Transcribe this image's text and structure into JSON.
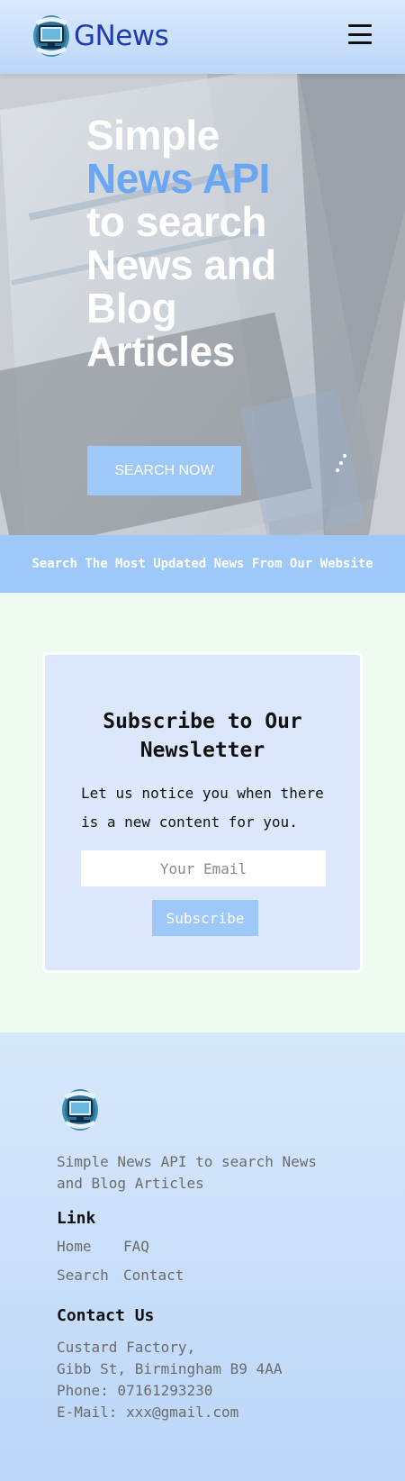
{
  "header": {
    "brand": "GNews",
    "logo_icon": "school-of-code-logo-icon",
    "menu_icon": "hamburger-menu-icon"
  },
  "hero": {
    "title_line1": "Simple",
    "title_accent": "News API",
    "title_line3": "to search",
    "title_line4": "News and",
    "title_line5": "Blog",
    "title_line6": "Articles",
    "button_label": "SEARCH NOW",
    "accent_color": "#6aa6f2"
  },
  "banner": {
    "text": "Search The Most Updated News From Our Website"
  },
  "newsletter": {
    "title": "Subscribe to Our Newsletter",
    "text": "Let us notice you when there is a new content for you.",
    "email_placeholder": "Your Email",
    "button_label": "Subscribe"
  },
  "footer": {
    "description": "Simple News API to search News and Blog Articles",
    "links_heading": "Link",
    "links": [
      "Home",
      "FAQ",
      "Search",
      "Contact"
    ],
    "contact_heading": "Contact Us",
    "address_line1": "Custard Factory,",
    "address_line2": "Gibb St, Birmingham B9 4AA",
    "phone": "Phone: 07161293230",
    "email": "E-Mail: xxx@gmail.com"
  },
  "colors": {
    "primary_light": "#9ec8f8",
    "brand_blue": "#1f3bb3",
    "newsletter_bg": "#eefbf0",
    "card_bg": "#dce7fb"
  }
}
